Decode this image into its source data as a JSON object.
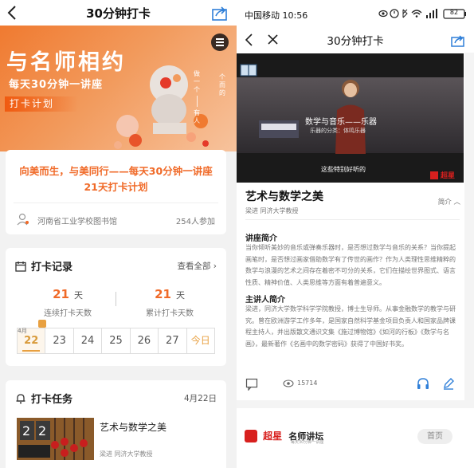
{
  "left": {
    "nav": {
      "title": "30分钟打卡"
    },
    "banner": {
      "headline": "与名师相约",
      "subhead": "每天30分钟一讲座",
      "tag": "打卡计划",
      "vertical_text_1": "做一个",
      "vertical_text_2": "有人",
      "vertical_text_3": "个而的"
    },
    "intro_card": {
      "heading_line1": "向美而生，与美同行——每天30分钟一讲座",
      "heading_line2": "21天打卡计划",
      "organization": "河南省工业学校图书馆",
      "participants": "254人参加"
    },
    "checkin_record": {
      "title": "打卡记录",
      "view_all": "查看全部",
      "streak_value": "21",
      "streak_unit": "天",
      "streak_label": "连续打卡天数",
      "total_value": "21",
      "total_unit": "天",
      "total_label": "累计打卡天数",
      "month_label": "4月",
      "days": [
        "22",
        "23",
        "24",
        "25",
        "26",
        "27",
        "今日"
      ]
    },
    "tasks": {
      "title": "打卡任务",
      "date": "4月22日",
      "item_title": "艺术与数学之美",
      "item_meta": "梁进 同济大学教授"
    }
  },
  "right": {
    "status_bar": {
      "carrier_time": "中国移动 10:56",
      "battery": "82"
    },
    "nav": {
      "title": "30分钟打卡"
    },
    "video": {
      "slide_title": "数学与音乐——乐器",
      "slide_sub": "乐器的分类：体鸣乐器",
      "caption": "这些特别好听的",
      "logo_text": "超星"
    },
    "lecture": {
      "title": "艺术与数学之美",
      "meta": "梁进 同济大学教授",
      "toggle": "简介"
    },
    "intro_section": {
      "heading": "讲座简介",
      "body": "当你倾听美妙的音乐或弹奏乐器时，是否想过数学与音乐的关系？当你提起画笔时，是否想过画家借助数学有了传世的画作？作为人类理性思维精粹的数学与浪漫的艺术之间存在着密不可分的关系，它们在描绘世界图式、语言性质、精神价值、人类思维等方面有着普遍意义。"
    },
    "speaker_section": {
      "heading": "主讲人简介",
      "body": "梁进，同济大学数学科学学院教授，博士生导师。从事金融数学的教学与研究。曾在欧洲游学工作多年，是国家自然科学基金项目负责人和国家品牌课程主持人，并出版散文通识文集《施过博物馆》《如河的行板》《数学与名画》，最新著作《名画中的数学密码》获得了中国好书奖。"
    },
    "actions": {
      "views": "15714"
    },
    "footer": {
      "brand_name": "名师讲坛",
      "brand_sub": "每天30分钟一讲座",
      "home": "首页"
    }
  },
  "colors": {
    "accent": "#f06a28",
    "gold": "#e8a040",
    "blue": "#2f7fd8"
  }
}
